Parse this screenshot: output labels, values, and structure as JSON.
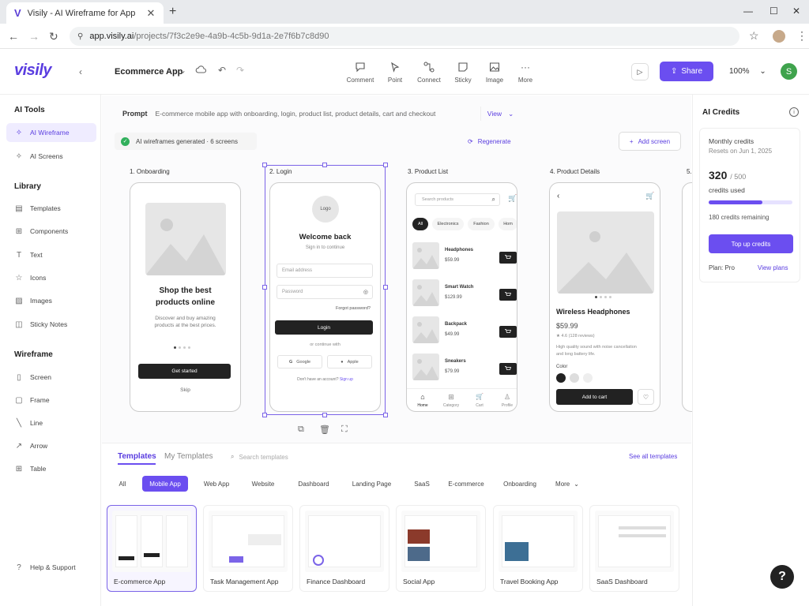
{
  "browser": {
    "tab_title": "Visily - AI Wireframe for App",
    "tab_favicon": "V",
    "url_host": "app.visily.ai",
    "url_path": "/projects/7f3c2e9e-4a9b-4c5b-9d1a-2e7f6b7c8d90"
  },
  "header": {
    "logo": "visily",
    "project_name": "Ecommerce App",
    "tools": [
      {
        "label": "Comment",
        "icon": "comment-icon"
      },
      {
        "label": "Point",
        "icon": "pointer-icon"
      },
      {
        "label": "Connect",
        "icon": "connect-icon"
      },
      {
        "label": "Sticky",
        "icon": "sticky-icon"
      },
      {
        "label": "Image",
        "icon": "image-icon"
      },
      {
        "label": "More",
        "icon": "more-icon"
      }
    ],
    "share_label": "Share",
    "zoom": "100%",
    "avatar_initial": "S"
  },
  "sidebar": {
    "ai_tools_title": "AI Tools",
    "ai_tools": [
      {
        "label": "AI Wireframe",
        "icon": "sparkle-icon",
        "active": true
      },
      {
        "label": "AI Screens",
        "icon": "sparkle-icon",
        "active": false
      }
    ],
    "library_title": "Library",
    "library": [
      {
        "label": "Templates",
        "icon": "template-icon"
      },
      {
        "label": "Components",
        "icon": "components-icon"
      },
      {
        "label": "Text",
        "icon": "text-icon"
      },
      {
        "label": "Icons",
        "icon": "star-icon"
      },
      {
        "label": "Images",
        "icon": "image-icon"
      },
      {
        "label": "Sticky Notes",
        "icon": "sticky-icon"
      }
    ],
    "wireframe_title": "Wireframe",
    "wireframe": [
      {
        "label": "Screen",
        "icon": "screen-icon"
      },
      {
        "label": "Frame",
        "icon": "frame-icon"
      },
      {
        "label": "Line",
        "icon": "line-icon"
      },
      {
        "label": "Arrow",
        "icon": "arrow-icon"
      },
      {
        "label": "Table",
        "icon": "table-icon"
      }
    ],
    "help_label": "Help & Support"
  },
  "canvas": {
    "prompt_label": "Prompt",
    "prompt_value": "E-commerce mobile app with onboarding, login, product list, product details, cart and checkout",
    "view_label": "View",
    "generated_text": "AI wireframes generated · 6 screens",
    "regenerate_label": "Regenerate",
    "add_screen_label": "Add screen",
    "screens": [
      {
        "label": "1. Onboarding"
      },
      {
        "label": "2. Login"
      },
      {
        "label": "3. Product List"
      },
      {
        "label": "4. Product Details"
      },
      {
        "label": "5."
      }
    ],
    "onboarding": {
      "title_line1": "Shop the best",
      "title_line2": "products online",
      "desc_line1": "Discover and buy amazing",
      "desc_line2": "products at the best prices.",
      "cta": "Get started",
      "skip": "Skip"
    },
    "login": {
      "logo": "Logo",
      "title": "Welcome back",
      "subtitle": "Sign in to continue",
      "email_placeholder": "Email address",
      "password_placeholder": "Password",
      "forgot": "Forgot password?",
      "cta": "Login",
      "or": "or continue with",
      "google": "Google",
      "apple": "Apple",
      "signup_prompt": "Don't have an account?",
      "signup_link": "Sign up"
    },
    "product_list": {
      "search_placeholder": "Search products",
      "chips": [
        "All",
        "Electronics",
        "Fashion",
        "Hom"
      ],
      "products": [
        {
          "name": "Headphones",
          "price": "$59.99"
        },
        {
          "name": "Smart Watch",
          "price": "$129.99"
        },
        {
          "name": "Backpack",
          "price": "$49.99"
        },
        {
          "name": "Sneakers",
          "price": "$79.99"
        }
      ],
      "tabs": [
        "Home",
        "Category",
        "Cart",
        "Profile"
      ]
    },
    "product_details": {
      "name": "Wireless Headphones",
      "price": "$59.99",
      "rating": "★ 4.6 (128 reviews)",
      "desc_line1": "High quality sound with noise cancellation",
      "desc_line2": "and long battery life.",
      "color_label": "Color",
      "cta": "Add to cart"
    }
  },
  "credits": {
    "title": "AI Credits",
    "monthly": "Monthly credits",
    "resets": "Resets on Jun 1, 2025",
    "used": "320",
    "total": "/ 500",
    "used_label": "credits used",
    "used_fraction": 0.64,
    "remaining": "180 credits remaining",
    "topup": "Top up credits",
    "plan": "Plan: Pro",
    "view_plans": "View plans"
  },
  "templates": {
    "tab_active": "Templates",
    "tab_other": "My Templates",
    "search_placeholder": "Search templates",
    "see_all": "See all templates",
    "filters": [
      "All",
      "Mobile App",
      "Web App",
      "Website",
      "Dashboard",
      "Landing Page",
      "SaaS",
      "E-commerce",
      "Onboarding",
      "More"
    ],
    "active_filter": "Mobile App",
    "cards": [
      {
        "label": "E-commerce App"
      },
      {
        "label": "Task Management App"
      },
      {
        "label": "Finance Dashboard"
      },
      {
        "label": "Social App"
      },
      {
        "label": "Travel Booking App"
      },
      {
        "label": "SaaS Dashboard"
      }
    ]
  },
  "help_glyph": "?",
  "colors": {
    "accent": "#6b4ef0",
    "success": "#31b05c",
    "avatar": "#3fa34d"
  }
}
